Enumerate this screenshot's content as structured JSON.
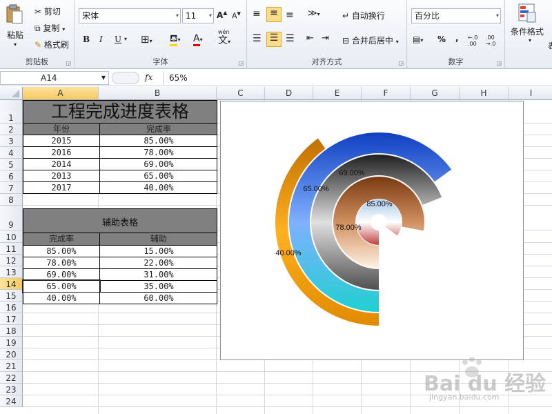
{
  "ribbon": {
    "clipboard": {
      "paste": "粘贴",
      "cut": "剪切",
      "copy": "复制",
      "format_painter": "格式刷",
      "label": "剪贴板"
    },
    "font": {
      "name": "宋体",
      "size": "11",
      "bold": "B",
      "italic": "I",
      "underline": "U",
      "phonetic": "wén",
      "label": "字体"
    },
    "alignment": {
      "wrap": "自动换行",
      "merge": "合并后居中",
      "label": "对齐方式"
    },
    "number": {
      "format": "百分比",
      "percent": "%",
      "comma": ",",
      "inc_decimal": "←.0 .00",
      "dec_decimal": ".00 →.0",
      "label": "数字"
    },
    "styles": {
      "conditional": "条件格式",
      "table_partial": "表"
    }
  },
  "formula_bar": {
    "name_box": "A14",
    "fx": "fx",
    "value": "65%"
  },
  "columns": [
    "A",
    "B",
    "C",
    "D",
    "E",
    "F",
    "G",
    "H",
    "I"
  ],
  "rows": [
    "1",
    "2",
    "3",
    "4",
    "5",
    "6",
    "7",
    "8",
    "9",
    "10",
    "11",
    "12",
    "13",
    "14",
    "15",
    "16",
    "17",
    "18",
    "19",
    "20",
    "21",
    "22",
    "23",
    "24"
  ],
  "table1": {
    "title": "工程完成进度表格",
    "headers": [
      "年份",
      "完成率"
    ],
    "rows": [
      [
        "2015",
        "85.00%"
      ],
      [
        "2016",
        "78.00%"
      ],
      [
        "2014",
        "69.00%"
      ],
      [
        "2013",
        "65.00%"
      ],
      [
        "2017",
        "40.00%"
      ]
    ]
  },
  "table2": {
    "title": "辅助表格",
    "headers": [
      "完成率",
      "辅助"
    ],
    "rows": [
      [
        "85.00%",
        "15.00%"
      ],
      [
        "78.00%",
        "22.00%"
      ],
      [
        "69.00%",
        "31.00%"
      ],
      [
        "65.00%",
        "35.00%"
      ],
      [
        "40.00%",
        "60.00%"
      ]
    ]
  },
  "chart_data": {
    "type": "doughnut",
    "series": [
      {
        "label": "85.00%",
        "value": 0.85,
        "color": "#2f80d0"
      },
      {
        "label": "78.00%",
        "value": 0.78,
        "color": "#a0522d"
      },
      {
        "label": "69.00%",
        "value": 0.69,
        "color": "#707070"
      },
      {
        "label": "65.00%",
        "value": 0.65,
        "color": "#1e6fd8"
      },
      {
        "label": "40.00%",
        "value": 0.4,
        "color": "#e08a00"
      }
    ]
  },
  "watermark": {
    "brand": "Bai du 经验",
    "url": "jingyan.baidu.com"
  }
}
